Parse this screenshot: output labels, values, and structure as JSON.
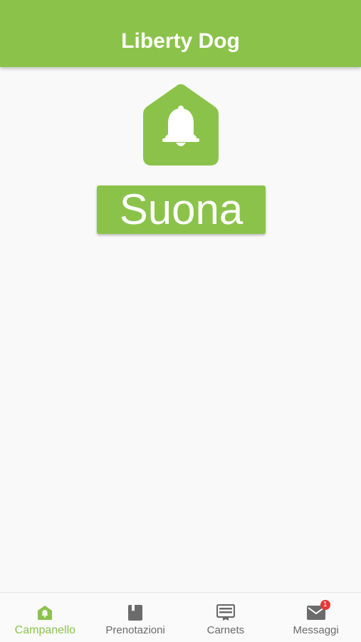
{
  "header": {
    "title": "Liberty Dog"
  },
  "main": {
    "ring_button_label": "Suona"
  },
  "bottom_nav": {
    "items": [
      {
        "label": "Campanello",
        "icon": "house-bell-icon",
        "active": true
      },
      {
        "label": "Prenotazioni",
        "icon": "book-icon",
        "active": false
      },
      {
        "label": "Carnets",
        "icon": "card-icon",
        "active": false
      },
      {
        "label": "Messaggi",
        "icon": "mail-icon",
        "active": false,
        "badge": "1"
      }
    ]
  },
  "colors": {
    "accent": "#8bc34a",
    "inactive": "#6b6b6b",
    "badge": "#e53935",
    "background": "#f9f9f9"
  }
}
